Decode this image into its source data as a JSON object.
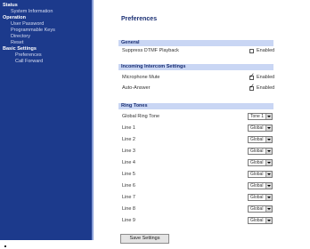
{
  "sidebar": {
    "status": "Status",
    "system_information": "System Information",
    "operation": "Operation",
    "user_password": "User Password",
    "programmable_keys": "Programmable Keys",
    "directory": "Directory",
    "reset": "Reset",
    "basic_settings": "Basic Settings",
    "preferences": "Preferences",
    "call_forward": "Call Forward"
  },
  "page": {
    "title": "Preferences"
  },
  "general": {
    "header": "General",
    "suppress_dtmf": "Suppress DTMF Playback",
    "suppress_dtmf_enabled": false,
    "enabled_label": "Enabled"
  },
  "intercom": {
    "header": "Incoming Intercom Settings",
    "microphone_mute": "Microphone Mute",
    "microphone_mute_enabled": true,
    "auto_answer": "Auto-Answer",
    "auto_answer_enabled": true,
    "enabled_label": "Enabled"
  },
  "ring_tones": {
    "header": "Ring Tones",
    "global_label": "Global Ring Tone",
    "global_value": "Tone 1",
    "lines": [
      {
        "label": "Line 1",
        "value": "Global"
      },
      {
        "label": "Line 2",
        "value": "Global"
      },
      {
        "label": "Line 3",
        "value": "Global"
      },
      {
        "label": "Line 4",
        "value": "Global"
      },
      {
        "label": "Line 5",
        "value": "Global"
      },
      {
        "label": "Line 6",
        "value": "Global"
      },
      {
        "label": "Line 7",
        "value": "Global"
      },
      {
        "label": "Line 8",
        "value": "Global"
      },
      {
        "label": "Line 9",
        "value": "Global"
      }
    ]
  },
  "save_button": "Save Settings",
  "colors": {
    "sidebar": "#1c3a8c",
    "band": "#c9d6f4",
    "title": "#1a2f73"
  }
}
